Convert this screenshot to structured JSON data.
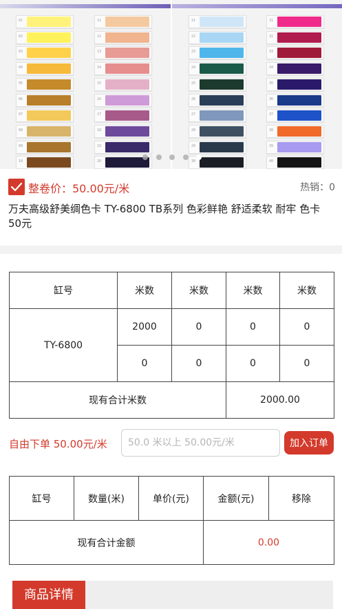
{
  "hero": {
    "left_cards": {
      "col1_codes": [
        "01",
        "02",
        "03",
        "04",
        "05",
        "06",
        "07",
        "08",
        "09",
        "10"
      ],
      "col1_colors": [
        "#fff27a",
        "#fff25a",
        "#ffd24a",
        "#f6b93a",
        "#c58a2a",
        "#b87e2a",
        "#f2c95a",
        "#d8b46a",
        "#a8752e",
        "#7a4a1e"
      ],
      "col2_codes": [
        "11",
        "12",
        "13",
        "14",
        "15",
        "16",
        "17",
        "18",
        "19",
        "20"
      ],
      "col2_colors": [
        "#f5c9a0",
        "#f0b48e",
        "#e89a94",
        "#e68e8e",
        "#e4b0c8",
        "#cf9ad8",
        "#a85a8a",
        "#6e4a9a",
        "#3a2a6a",
        "#1e1a3a"
      ]
    },
    "right_cards": {
      "col1_codes": [
        "21",
        "22",
        "23",
        "24",
        "25",
        "26",
        "27",
        "28",
        "29",
        "30"
      ],
      "col1_colors": [
        "#cfe6f8",
        "#a8d6f4",
        "#4fb6ec",
        "#1a5a48",
        "#1c3a2e",
        "#2a3e58",
        "#7f98bc",
        "#3e5062",
        "#2a3a4a",
        "#1a1e24"
      ],
      "col2_codes": [
        "31",
        "32",
        "33",
        "34",
        "35",
        "36",
        "37",
        "38",
        "39",
        "40"
      ],
      "col2_colors": [
        "#f02a8a",
        "#b01c4e",
        "#a01a3a",
        "#3a1a6a",
        "#2a1a6a",
        "#1a3a8a",
        "#1e52c8",
        "#f06a2a",
        "#a89aef",
        "#141414"
      ]
    },
    "dots": 5,
    "active_dot": 4
  },
  "price": {
    "checked": true,
    "label": "整卷价：50.00元/米",
    "hot": "热销：0"
  },
  "product_title": "万夫高级舒美绸色卡 TY-6800 TB系列 色彩鲜艳 舒适柔软 耐牢 色卡 50元",
  "stock_table": {
    "headers": [
      "缸号",
      "米数",
      "米数",
      "米数",
      "米数"
    ],
    "batch": "TY-6800",
    "row1": [
      "2000",
      "0",
      "0",
      "0"
    ],
    "row2": [
      "0",
      "0",
      "0",
      "0"
    ],
    "total_label": "现有合计米数",
    "total_value": "2000.00"
  },
  "order": {
    "label": "自由下单 50.00元/米",
    "placeholder": "50.0 米以上 50.00元/米",
    "value": "",
    "button": "加入订单"
  },
  "order_table": {
    "headers": [
      "缸号",
      "数量(米)",
      "单价(元)",
      "金额(元)",
      "移除"
    ],
    "total_label": "现有合计金额",
    "total_value": "0.00"
  },
  "detail_tab": "商品详情",
  "colors": {
    "accent": "#d33a2c",
    "border": "#444444"
  }
}
